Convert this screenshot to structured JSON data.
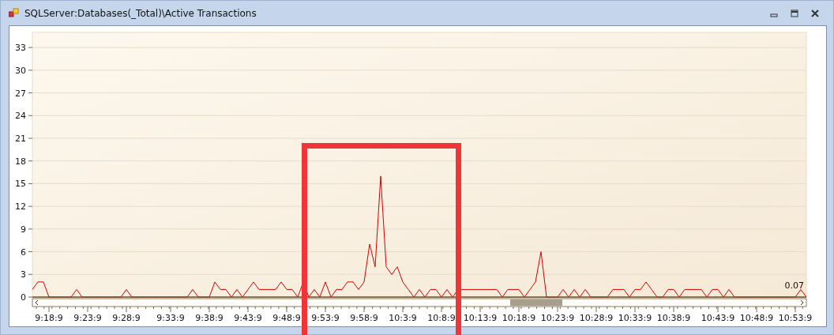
{
  "window": {
    "title": "SQLServer:Databases(_Total)\\Active Transactions"
  },
  "chart": {
    "chart_data": {
      "type": "line",
      "grid": true,
      "ylim": [
        0,
        35
      ],
      "yticks": [
        33,
        30,
        27,
        24,
        21,
        18,
        15,
        12,
        9,
        6,
        3,
        0
      ],
      "categories": [
        null,
        null,
        null,
        "9:18:9",
        null,
        null,
        null,
        null,
        null,
        null,
        "9:23:9",
        null,
        null,
        null,
        null,
        null,
        null,
        "9:28:9",
        null,
        null,
        null,
        null,
        null,
        null,
        null,
        "9:33:9",
        null,
        null,
        null,
        null,
        null,
        null,
        "9:38:9",
        null,
        null,
        null,
        null,
        null,
        null,
        "9:43:9",
        null,
        null,
        null,
        null,
        null,
        null,
        "9:48:9",
        null,
        null,
        null,
        null,
        null,
        null,
        "9:53:9",
        null,
        null,
        null,
        null,
        null,
        null,
        "9:58:9",
        null,
        null,
        null,
        null,
        null,
        null,
        "10:3:9",
        null,
        null,
        null,
        null,
        null,
        null,
        "10:8:9",
        null,
        null,
        null,
        null,
        null,
        null,
        "10:13:9",
        null,
        null,
        null,
        null,
        null,
        null,
        "10:18:9",
        null,
        null,
        null,
        null,
        null,
        null,
        "10:23:9",
        null,
        null,
        null,
        null,
        null,
        null,
        "10:28:9",
        null,
        null,
        null,
        null,
        null,
        null,
        "10:33:9",
        null,
        null,
        null,
        null,
        null,
        null,
        "10:38:9",
        null,
        null,
        null,
        null,
        null,
        null,
        null,
        "10:43:9",
        null,
        null,
        null,
        null,
        null,
        null,
        "10:48:9",
        null,
        null,
        null,
        null,
        null,
        null,
        "10:53:9",
        null,
        null
      ],
      "series": [
        {
          "color": "#d40000",
          "values": [
            1,
            2,
            2,
            0,
            0,
            0,
            0,
            0,
            1,
            0,
            0,
            0,
            0,
            0,
            0,
            0,
            0,
            1,
            0,
            0,
            0,
            0,
            0,
            0,
            0,
            0,
            0,
            0,
            0,
            1,
            0,
            0,
            0,
            2,
            1,
            1,
            0,
            1,
            0,
            1,
            2,
            1,
            1,
            1,
            1,
            2,
            1,
            1,
            0,
            2,
            0,
            1,
            0,
            2,
            0,
            1,
            1,
            2,
            2,
            1,
            2,
            7,
            4,
            16,
            4,
            3,
            4,
            2,
            1,
            0,
            1,
            0,
            1,
            1,
            0,
            1,
            0,
            1,
            1,
            1,
            1,
            1,
            1,
            1,
            1,
            0,
            1,
            1,
            1,
            0,
            1,
            2,
            6,
            0,
            0,
            0,
            1,
            0,
            1,
            0,
            1,
            0,
            0,
            0,
            0,
            1,
            1,
            1,
            0,
            1,
            1,
            2,
            1,
            0,
            0,
            1,
            1,
            0,
            1,
            1,
            1,
            1,
            0,
            1,
            1,
            0,
            1,
            0,
            0,
            0,
            0,
            0,
            0,
            0,
            0,
            0,
            0,
            0,
            0,
            1,
            0
          ]
        }
      ]
    },
    "current_value": "0.07",
    "annotation": {
      "kind": "highlight-box"
    }
  }
}
